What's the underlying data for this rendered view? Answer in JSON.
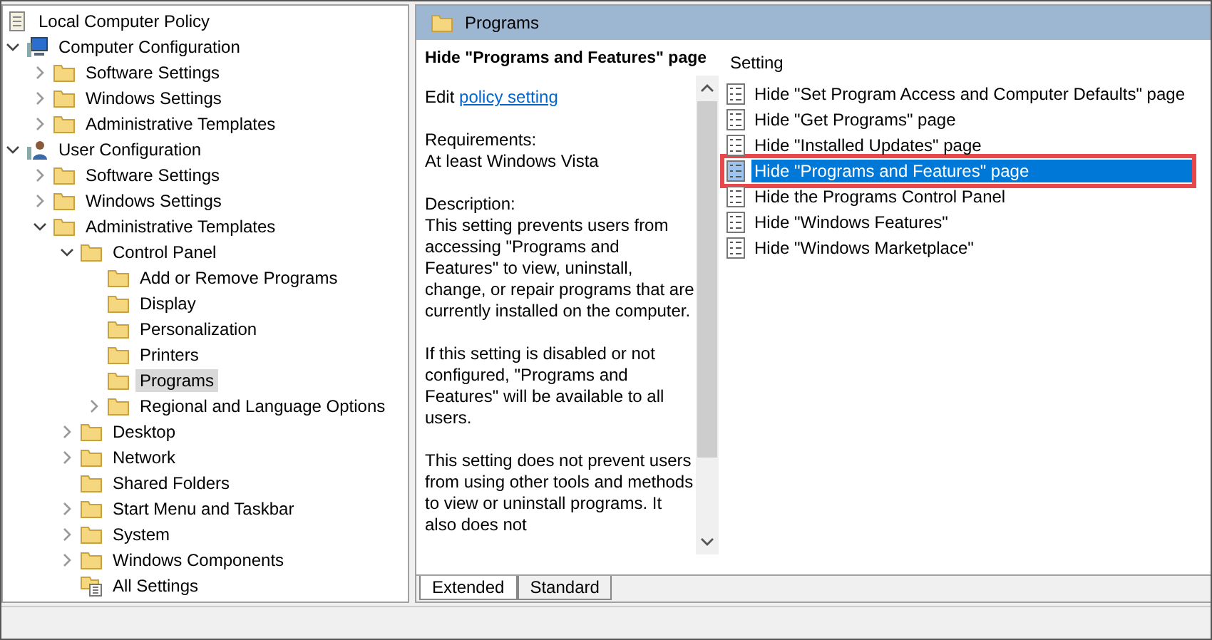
{
  "tree": [
    {
      "label": "Local Computer Policy",
      "kind": "policy",
      "selected": false,
      "children": [
        {
          "label": "Computer Configuration",
          "kind": "computer",
          "expanded": true,
          "selected": false,
          "children": [
            {
              "label": "Software Settings",
              "kind": "folder",
              "expanded": false,
              "selected": false
            },
            {
              "label": "Windows Settings",
              "kind": "folder",
              "expanded": false,
              "selected": false
            },
            {
              "label": "Administrative Templates",
              "kind": "folder",
              "expanded": false,
              "selected": false
            }
          ]
        },
        {
          "label": "User Configuration",
          "kind": "user",
          "expanded": true,
          "selected": false,
          "children": [
            {
              "label": "Software Settings",
              "kind": "folder",
              "expanded": false,
              "selected": false
            },
            {
              "label": "Windows Settings",
              "kind": "folder",
              "expanded": false,
              "selected": false
            },
            {
              "label": "Administrative Templates",
              "kind": "folder",
              "expanded": true,
              "selected": false,
              "children": [
                {
                  "label": "Control Panel",
                  "kind": "folder",
                  "expanded": true,
                  "selected": false,
                  "children": [
                    {
                      "label": "Add or Remove Programs",
                      "kind": "folder",
                      "selected": false
                    },
                    {
                      "label": "Display",
                      "kind": "folder",
                      "selected": false
                    },
                    {
                      "label": "Personalization",
                      "kind": "folder",
                      "selected": false
                    },
                    {
                      "label": "Printers",
                      "kind": "folder",
                      "selected": false
                    },
                    {
                      "label": "Programs",
                      "kind": "folder",
                      "selected": true
                    },
                    {
                      "label": "Regional and Language Options",
                      "kind": "folder",
                      "expanded": false,
                      "selected": false
                    }
                  ]
                },
                {
                  "label": "Desktop",
                  "kind": "folder",
                  "expanded": false,
                  "selected": false
                },
                {
                  "label": "Network",
                  "kind": "folder",
                  "expanded": false,
                  "selected": false
                },
                {
                  "label": "Shared Folders",
                  "kind": "folder",
                  "selected": false
                },
                {
                  "label": "Start Menu and Taskbar",
                  "kind": "folder",
                  "expanded": false,
                  "selected": false
                },
                {
                  "label": "System",
                  "kind": "folder",
                  "expanded": false,
                  "selected": false
                },
                {
                  "label": "Windows Components",
                  "kind": "folder",
                  "expanded": false,
                  "selected": false
                },
                {
                  "label": "All Settings",
                  "kind": "all-settings",
                  "selected": false
                }
              ]
            }
          ]
        }
      ]
    }
  ],
  "header": {
    "title": "Programs"
  },
  "details": {
    "title": "Hide \"Programs and Features\" page",
    "edit_prefix": "Edit",
    "edit_link": "policy setting",
    "requirements_label": "Requirements:",
    "requirements": "At least Windows Vista",
    "description_label": "Description:",
    "paragraphs": [
      "This setting prevents users from accessing \"Programs and Features\" to view, uninstall, change, or repair programs that are currently installed on the computer.",
      "If this setting is disabled or not configured, \"Programs and Features\" will be available to all users.",
      "This setting does not prevent users from using other tools and methods to view or uninstall programs.  It also does not"
    ]
  },
  "settings": {
    "column": "Setting",
    "rows": [
      {
        "label": "Hide \"Set Program Access and Computer Defaults\" page",
        "selected": false,
        "annotated": false
      },
      {
        "label": "Hide \"Get Programs\" page",
        "selected": false,
        "annotated": false
      },
      {
        "label": "Hide \"Installed Updates\" page",
        "selected": false,
        "annotated": false
      },
      {
        "label": "Hide \"Programs and Features\" page",
        "selected": true,
        "annotated": true
      },
      {
        "label": "Hide the Programs Control Panel",
        "selected": false,
        "annotated": false
      },
      {
        "label": "Hide \"Windows Features\"",
        "selected": false,
        "annotated": false
      },
      {
        "label": "Hide \"Windows Marketplace\"",
        "selected": false,
        "annotated": false
      }
    ]
  },
  "tabs": [
    {
      "label": "Extended",
      "selected": true
    },
    {
      "label": "Standard",
      "selected": false
    }
  ]
}
